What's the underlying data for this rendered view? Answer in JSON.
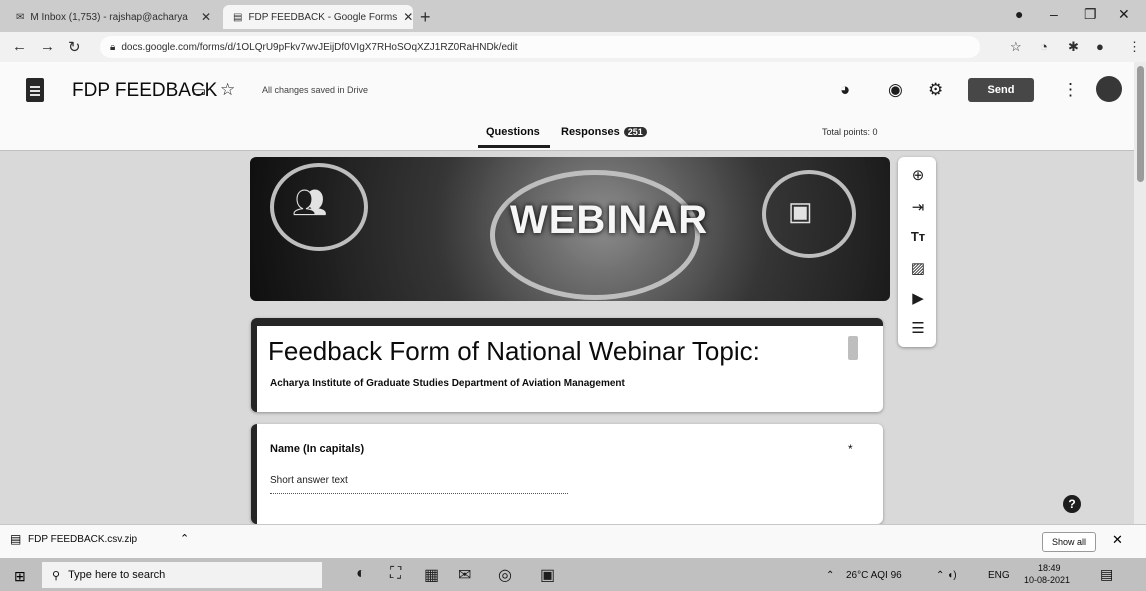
{
  "browser": {
    "tabs": [
      {
        "label": "M Inbox (1,753) - rajshap@acharya",
        "icon": "mail-icon"
      },
      {
        "label": "FDP FEEDBACK - Google Forms",
        "icon": "forms-icon"
      }
    ],
    "url": "docs.google.com/forms/d/1OLQrU9pFkv7wvJEijDf0VIgX7RHoSOqXZJ1RZ0RaHNDk/edit"
  },
  "forms_header": {
    "doc_title": "FDP FEEDBACK",
    "saved_status": "All changes saved in Drive",
    "send_label": "Send",
    "tabs": {
      "questions": "Questions",
      "responses": "Responses",
      "responses_count": "251"
    },
    "total_points": "Total points: 0"
  },
  "banner": {
    "text": "WEBINAR"
  },
  "form": {
    "title": "Feedback Form of National Webinar    Topic:",
    "description": "Acharya Institute of Graduate Studies Department of Aviation Management"
  },
  "question": {
    "title": "Name (In capitals)",
    "required_mark": "*",
    "placeholder": "Short answer text"
  },
  "download_bar": {
    "filename": "FDP FEEDBACK.csv.zip",
    "show_all": "Show all"
  },
  "taskbar": {
    "search_placeholder": "Type here to search",
    "weather": "26°C AQI 96",
    "language": "ENG",
    "time": "18:49",
    "date": "10-08-2021"
  }
}
